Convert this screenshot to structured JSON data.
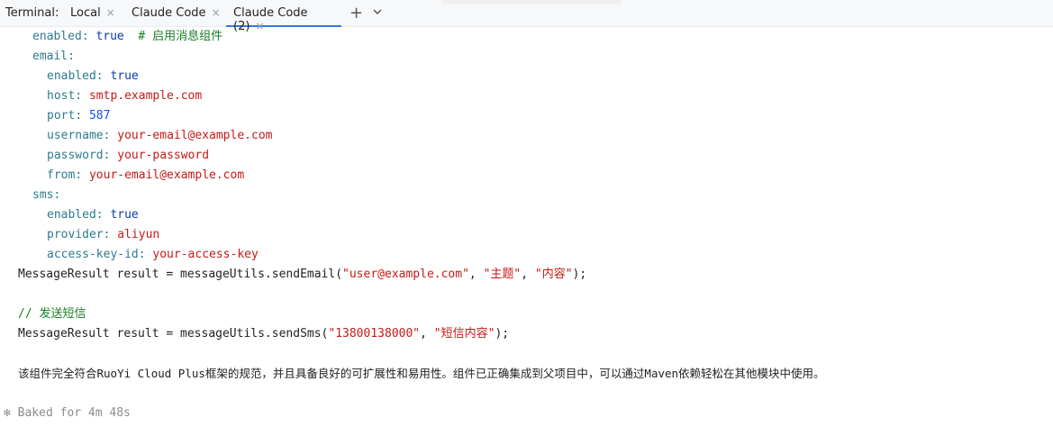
{
  "tabbar": {
    "label": "Terminal:",
    "tabs": [
      {
        "label": "Local"
      },
      {
        "label": "Claude Code"
      },
      {
        "label": "Claude Code (2)"
      }
    ],
    "close_glyph": "×",
    "add_glyph": "+"
  },
  "icons": {
    "close": "close-icon",
    "add": "plus-icon",
    "dropdown": "chevron-down-icon"
  },
  "lines": {
    "l1": {
      "key": "enabled: ",
      "val": "true",
      "comment": "  # 启用消息组件"
    },
    "l2": {
      "key": "email:"
    },
    "l3": {
      "key": "enabled: ",
      "val": "true"
    },
    "l4": {
      "key": "host: ",
      "val": "smtp.example.com"
    },
    "l5": {
      "key": "port: ",
      "val": "587"
    },
    "l6": {
      "key": "username: ",
      "val": "your-email@example.com"
    },
    "l7": {
      "key": "password: ",
      "val": "your-password"
    },
    "l8": {
      "key": "from: ",
      "val": "your-email@example.com"
    },
    "l9": {
      "key": "sms:"
    },
    "l10": {
      "key": "enabled: ",
      "val": "true"
    },
    "l11": {
      "key": "provider: ",
      "val": "aliyun"
    },
    "l12": {
      "key": "access-key-id: ",
      "val": "your-access-key"
    },
    "l13": {
      "pre": "MessageResult result = messageUtils.sendEmail(",
      "s1": "\"user@example.com\"",
      "sep1": ", ",
      "s2": "\"主题\"",
      "sep2": ", ",
      "s3": "\"内容\"",
      "post": ");"
    },
    "l14": {
      "comment": "// 发送短信"
    },
    "l15": {
      "pre": "MessageResult result = messageUtils.sendSms(",
      "s1": "\"13800138000\"",
      "sep1": ", ",
      "s2": "\"短信内容\"",
      "post": ");"
    },
    "l16": {
      "text": "该组件完全符合RuoYi Cloud Plus框架的规范，并且具备良好的可扩展性和易用性。组件已正确集成到父项目中，可以通过Maven依赖轻松在其他模块中使用。"
    },
    "l17": {
      "glyph": "✻",
      "text": " Baked for 4m 48s"
    }
  },
  "colors": {
    "tab_active_underline": "#3574f0",
    "yaml_key": "#2e7a8e",
    "string": "#c41a16",
    "comment": "#1a7f24"
  }
}
